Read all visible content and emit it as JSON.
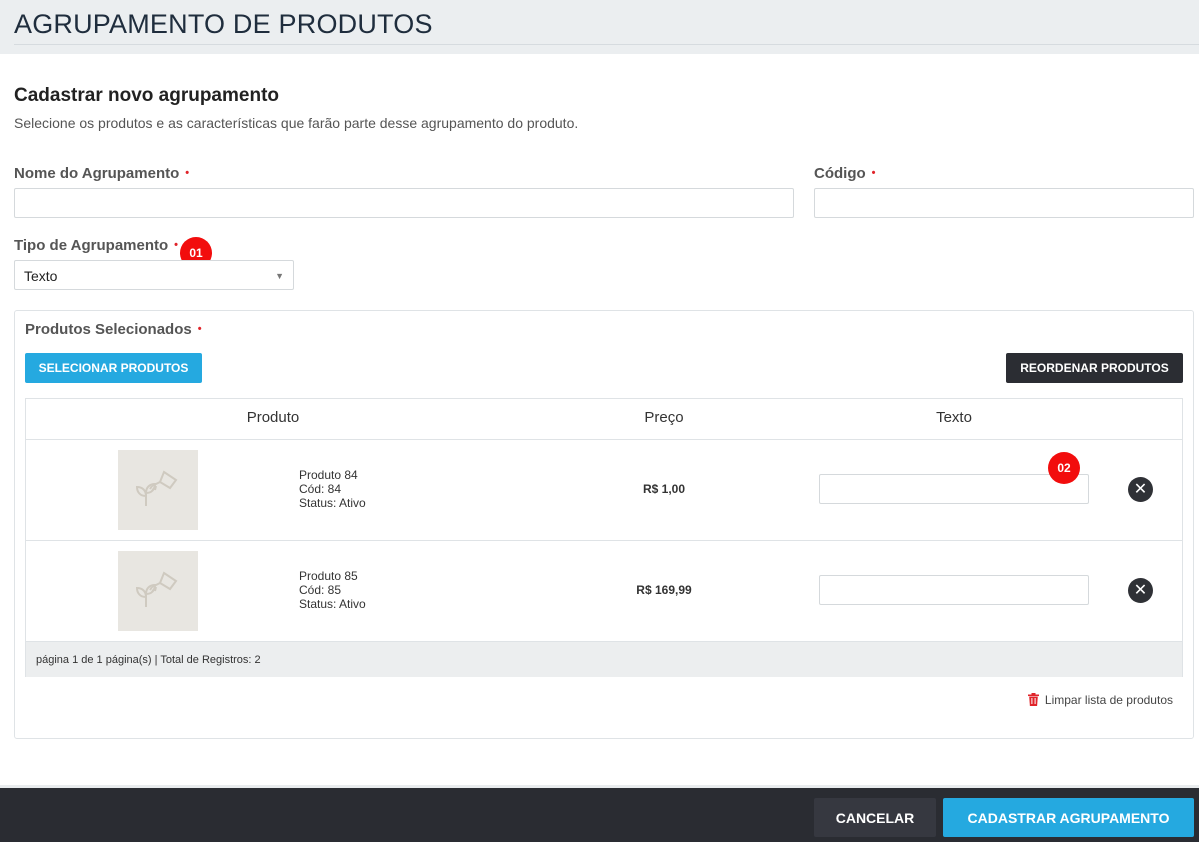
{
  "header": {
    "title": "AGRUPAMENTO DE PRODUTOS"
  },
  "form": {
    "section_title": "Cadastrar novo agrupamento",
    "section_subtitle": "Selecione os produtos e as características que farão parte desse agrupamento do produto.",
    "name_label": "Nome do Agrupamento",
    "name_value": "",
    "code_label": "Código",
    "code_value": "",
    "type_label": "Tipo de Agrupamento",
    "type_value": "Texto",
    "required_mark": "•"
  },
  "badges": {
    "first": "01",
    "second": "02"
  },
  "products_panel": {
    "label": "Produtos Selecionados",
    "select_button": "SELECIONAR PRODUTOS",
    "reorder_button": "REORDENAR PRODUTOS",
    "columns": [
      "Produto",
      "Preço",
      "Texto"
    ],
    "rows": [
      {
        "name": "Produto 84",
        "code": "Cód: 84",
        "status": "Status: Ativo",
        "price": "R$ 1,00",
        "text_value": ""
      },
      {
        "name": "Produto 85",
        "code": "Cód: 85",
        "status": "Status: Ativo",
        "price": "R$ 169,99",
        "text_value": ""
      }
    ],
    "pagination": "página 1 de 1 página(s) | Total de Registros: 2",
    "clear_link": "Limpar lista de produtos"
  },
  "footer": {
    "cancel_button": "CANCELAR",
    "submit_button": "CADASTRAR AGRUPAMENTO"
  },
  "colors": {
    "accent": "#25a9e0",
    "dark": "#2b2d33",
    "badge": "#f20d0d",
    "required": "#e0242a"
  },
  "icons": {
    "remove": "close-icon",
    "clear": "trash-icon",
    "thumb": "plant-watering-icon",
    "caret": "caret-down-icon"
  }
}
